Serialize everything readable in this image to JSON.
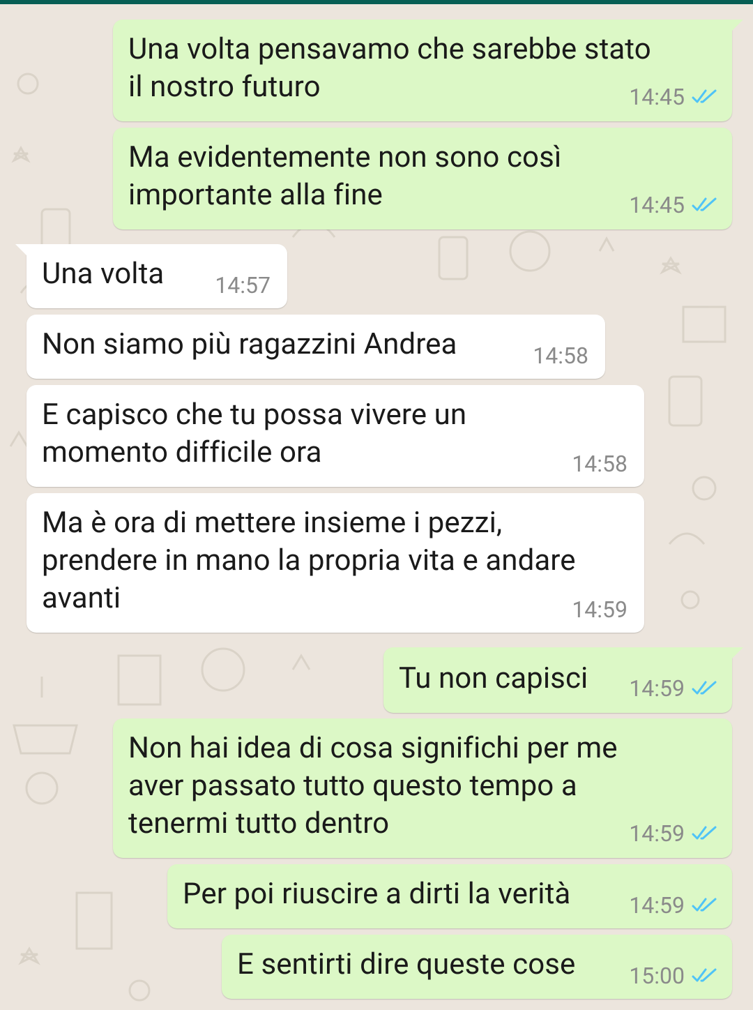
{
  "colors": {
    "outgoing_bubble": "#dcf8c6",
    "incoming_bubble": "#ffffff",
    "background": "#ece5dd",
    "read_ticks": "#4fc3f7",
    "header": "#075e54"
  },
  "messages": [
    {
      "direction": "outgoing",
      "text": "Una volta pensavamo che sarebbe stato\nil nostro futuro",
      "time": "14:45",
      "status_icon": "double-check-read-icon"
    },
    {
      "direction": "outgoing",
      "text": "Ma evidentemente non sono così\nimportante alla fine",
      "time": "14:45",
      "status_icon": "double-check-read-icon"
    },
    {
      "direction": "incoming",
      "text": "Una volta",
      "time": "14:57"
    },
    {
      "direction": "incoming",
      "text": "Non siamo più ragazzini Andrea",
      "time": "14:58"
    },
    {
      "direction": "incoming",
      "text": "E capisco che tu possa vivere un\nmomento difficile ora",
      "time": "14:58"
    },
    {
      "direction": "incoming",
      "text": "Ma è ora di mettere insieme i pezzi,\nprendere in mano la propria vita e andare\navanti",
      "time": "14:59"
    },
    {
      "direction": "outgoing",
      "text": "Tu non capisci",
      "time": "14:59",
      "status_icon": "double-check-read-icon"
    },
    {
      "direction": "outgoing",
      "text": "Non hai idea di cosa significhi per me\naver passato tutto questo tempo a\ntenermi tutto dentro",
      "time": "14:59",
      "status_icon": "double-check-read-icon"
    },
    {
      "direction": "outgoing",
      "text": "Per poi riuscire a dirti la verità",
      "time": "14:59",
      "status_icon": "double-check-read-icon"
    },
    {
      "direction": "outgoing",
      "text": "E sentirti dire queste cose",
      "time": "15:00",
      "status_icon": "double-check-read-icon"
    }
  ]
}
